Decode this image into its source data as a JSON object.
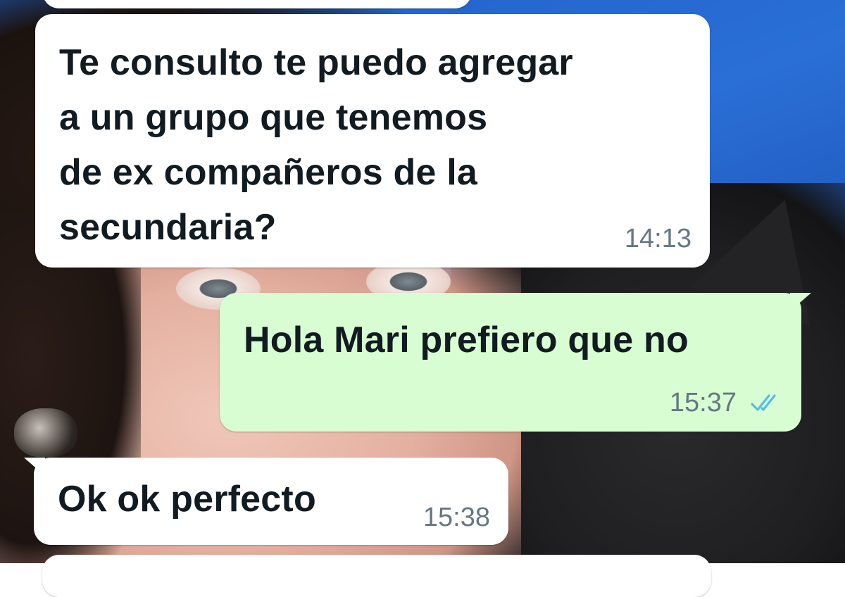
{
  "messages": [
    {
      "direction": "incoming",
      "lines": [
        "Te consulto te puedo agregar",
        "a un grupo que tenemos",
        "de ex compañeros de la",
        "secundaria?"
      ],
      "time": "14:13"
    },
    {
      "direction": "outgoing",
      "lines": [
        "Hola Mari prefiero que no"
      ],
      "time": "15:37",
      "status": "read",
      "status_icon": "double-check-icon"
    },
    {
      "direction": "incoming",
      "lines": [
        "Ok ok perfecto"
      ],
      "time": "15:38"
    }
  ],
  "colors": {
    "incoming_bubble": "#ffffff",
    "outgoing_bubble": "#d9fdd3",
    "timestamp": "#667781",
    "read_tick": "#53bdeb"
  }
}
